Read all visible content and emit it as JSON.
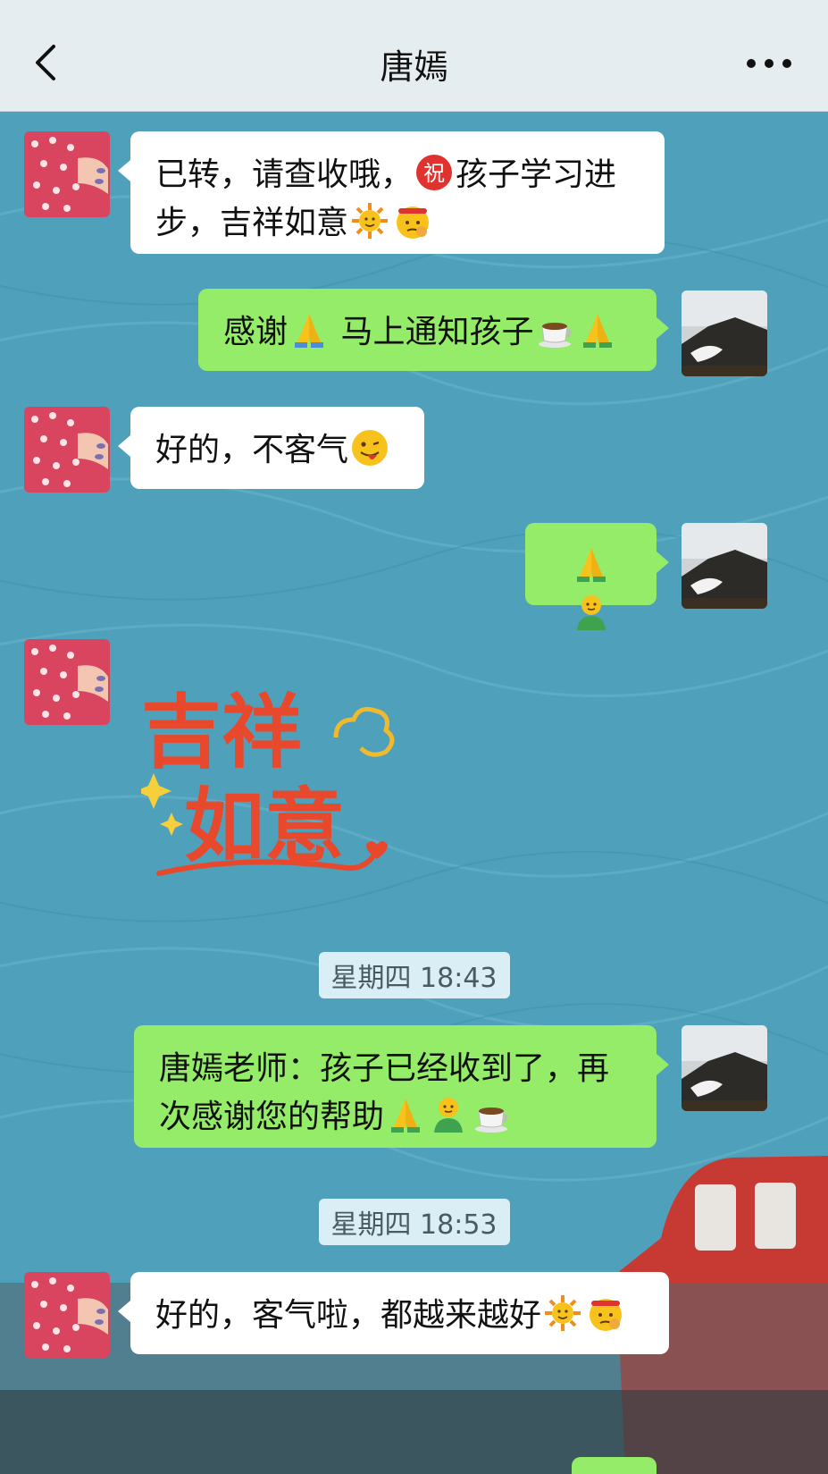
{
  "header": {
    "title": "唐嫣",
    "back_icon": "chevron-left-icon",
    "more_icon": "more-dots-icon"
  },
  "messages": {
    "m1": {
      "sender": "contact",
      "line1": "已转，请查收哦，",
      "line1b": "孩子学习进",
      "line2": "步，吉祥如意"
    },
    "m2": {
      "sender": "me",
      "text_a": "感谢",
      "text_b": "马上通知孩子"
    },
    "m3": {
      "sender": "contact",
      "text": "好的，不客气"
    },
    "m4": {
      "sender": "me"
    },
    "m5": {
      "sender": "contact",
      "sticker_line1": "吉祥",
      "sticker_line2": "如意"
    },
    "m6": {
      "sender": "me",
      "line1": "唐嫣老师：孩子已经收到了，再",
      "line2": "次感谢您的帮助"
    },
    "m7": {
      "sender": "contact",
      "text": "好的，客气啦，都越来越好"
    }
  },
  "timestamps": {
    "t1": "星期四 18:43",
    "t2": "星期四 18:53"
  },
  "emoji_chars": {
    "zhu": "祝"
  },
  "colors": {
    "chat_background": "#4fa1bb",
    "outgoing_bubble": "#95ec69",
    "incoming_bubble": "#ffffff"
  }
}
